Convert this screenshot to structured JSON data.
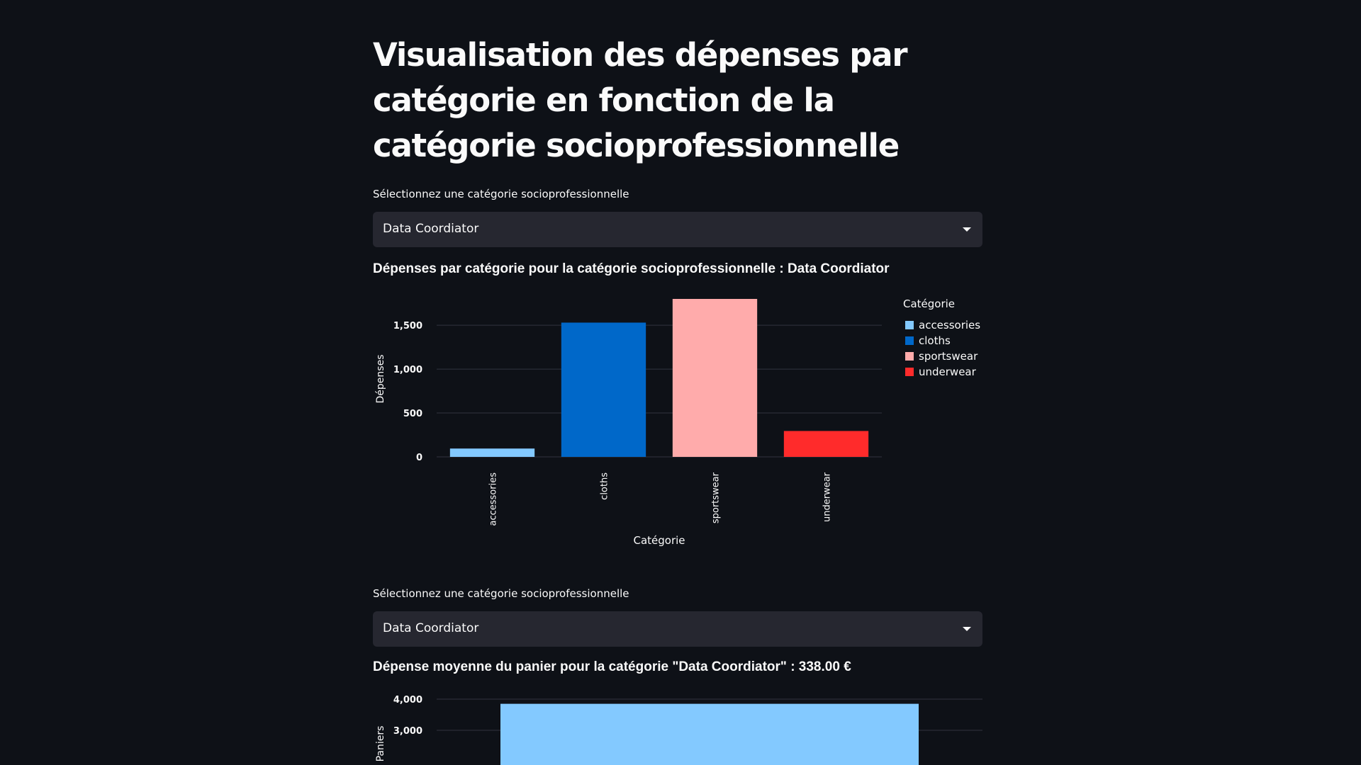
{
  "page_title": "Visualisation des dépenses par catégorie en fonction de la catégorie socioprofessionnelle",
  "section1": {
    "select_label": "Sélectionnez une catégorie socioprofessionnelle",
    "select_value": "Data Coordiator",
    "chart_title": "Dépenses par catégorie pour la catégorie socioprofessionnelle : Data Coordiator"
  },
  "section2": {
    "select_label": "Sélectionnez une catégorie socioprofessionnelle",
    "select_value": "Data Coordiator",
    "chart_title": "Dépense moyenne du panier pour la catégorie \"Data Coordiator\" : 338.00 €"
  },
  "colors": {
    "accessories": "#83c9ff",
    "cloths": "#0068c9",
    "sportswear": "#ffabab",
    "underwear": "#ff2b2b",
    "grid": "#31333f",
    "axis_text": "#fafafa"
  },
  "chart_data": [
    {
      "type": "bar",
      "categories": [
        "accessories",
        "cloths",
        "sportswear",
        "underwear"
      ],
      "values": [
        95,
        1530,
        1800,
        295
      ],
      "xlabel": "Catégorie",
      "ylabel": "Dépenses",
      "yticks": [
        0,
        500,
        1000,
        1500
      ],
      "ytick_labels": [
        "0",
        "500",
        "1,000",
        "1,500"
      ],
      "ylim": [
        0,
        1800
      ],
      "grid": true,
      "legend": {
        "title": "Catégorie",
        "position": "right",
        "items": [
          "accessories",
          "cloths",
          "sportswear",
          "underwear"
        ]
      }
    },
    {
      "type": "bar",
      "categories": [
        ""
      ],
      "values": [
        3850
      ],
      "ylabel": "Paniers",
      "yticks": [
        3000,
        4000
      ],
      "ytick_labels": [
        "3,000",
        "4,000"
      ],
      "ylim": [
        0,
        4000
      ],
      "grid": true
    }
  ]
}
